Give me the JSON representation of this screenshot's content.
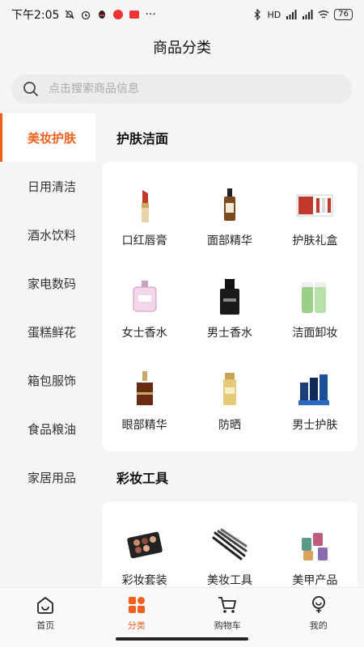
{
  "status_bar": {
    "time": "下午2:05",
    "more": "···",
    "battery": "76",
    "network": "HD"
  },
  "header": {
    "title": "商品分类"
  },
  "search": {
    "placeholder": "点击搜索商品信息"
  },
  "sidebar": {
    "items": [
      {
        "label": "美妆护肤",
        "active": true
      },
      {
        "label": "日用清洁"
      },
      {
        "label": "酒水饮料"
      },
      {
        "label": "家电数码"
      },
      {
        "label": "蛋糕鲜花"
      },
      {
        "label": "箱包服饰"
      },
      {
        "label": "食品粮油"
      },
      {
        "label": "家居用品"
      }
    ]
  },
  "sections": [
    {
      "title": "护肤洁面",
      "items": [
        {
          "label": "口红唇膏",
          "icon": "lipstick-icon"
        },
        {
          "label": "面部精华",
          "icon": "serum-bottle-icon"
        },
        {
          "label": "护肤礼盒",
          "icon": "gift-box-icon"
        },
        {
          "label": "女士香水",
          "icon": "perfume-icon"
        },
        {
          "label": "男士香水",
          "icon": "mens-perfume-icon"
        },
        {
          "label": "洁面卸妆",
          "icon": "cleanser-tubes-icon"
        },
        {
          "label": "眼部精华",
          "icon": "eye-serum-icon"
        },
        {
          "label": "防晒",
          "icon": "sunscreen-icon"
        },
        {
          "label": "男士护肤",
          "icon": "mens-skincare-icon"
        }
      ]
    },
    {
      "title": "彩妆工具",
      "items": [
        {
          "label": "彩妆套装",
          "icon": "makeup-palette-icon"
        },
        {
          "label": "美妆工具",
          "icon": "brush-set-icon"
        },
        {
          "label": "美甲产品",
          "icon": "nail-polish-icon"
        }
      ]
    }
  ],
  "tabbar": {
    "items": [
      {
        "label": "首页",
        "icon": "home-icon"
      },
      {
        "label": "分类",
        "icon": "category-icon",
        "active": true
      },
      {
        "label": "购物车",
        "icon": "cart-icon"
      },
      {
        "label": "我的",
        "icon": "profile-icon"
      }
    ]
  },
  "colors": {
    "accent": "#f25f1d"
  }
}
